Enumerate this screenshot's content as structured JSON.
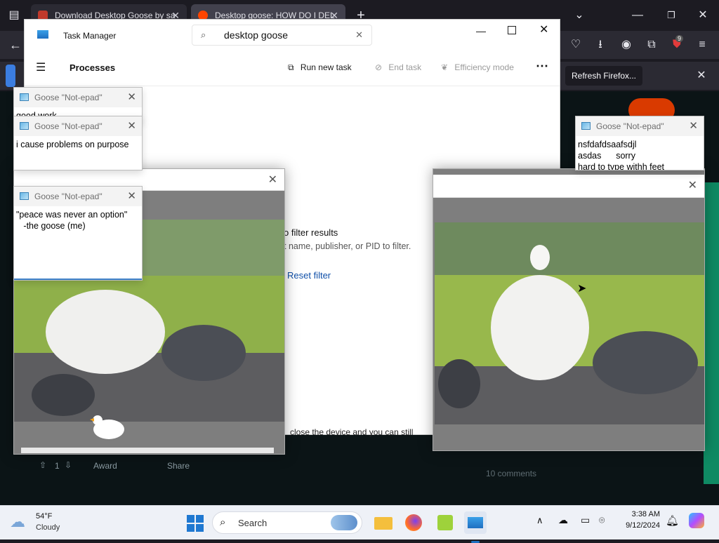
{
  "browser": {
    "tabs": [
      {
        "label": "Download Desktop Goose by sa",
        "active": false
      },
      {
        "label": "Desktop goose: HOW DO I DEL",
        "active": true
      }
    ],
    "refresh_button": "Refresh Firefox...",
    "extension_badge": "9"
  },
  "task_manager": {
    "title": "Task Manager",
    "search_value": "desktop goose",
    "page_title": "Processes",
    "run_new_task": "Run new task",
    "end_task": "End task",
    "efficiency_mode": "Efficiency mode",
    "empty_heading_fragment": "o filter results",
    "empty_hint_fragment": "t name, publisher, or PID to filter.",
    "reset_filter": "Reset filter"
  },
  "background_page": {
    "comment_fragment": "close the device and you can still",
    "vote_count": "1",
    "award": "Award",
    "share": "Share",
    "comments_count": "10 comments"
  },
  "notepads": [
    {
      "title": "Goose \"Not-epad\"",
      "text": "good work"
    },
    {
      "title": "Goose \"Not-epad\"",
      "text": "i cause problems on purpose"
    },
    {
      "title": "Goose \"Not-epad\"",
      "text": "\"peace was never an option\"\n   -the goose (me)"
    },
    {
      "title": "Goose \"Not-epad\"",
      "text": "nsfdafdsaafsdjl\nasdas      sorry\nhard to type withh feet"
    }
  ],
  "taskbar": {
    "weather_temp": "54°F",
    "weather_desc": "Cloudy",
    "search_placeholder": "Search",
    "time": "3:38 AM",
    "date": "9/12/2024"
  },
  "colors": {
    "firefox_dark": "#1c1b22",
    "firefox_toolbar": "#2b2a33",
    "task_manager_bg": "#ffffff",
    "accent_blue": "#0f4fa8",
    "taskbar_bg": "#eef1f7"
  }
}
